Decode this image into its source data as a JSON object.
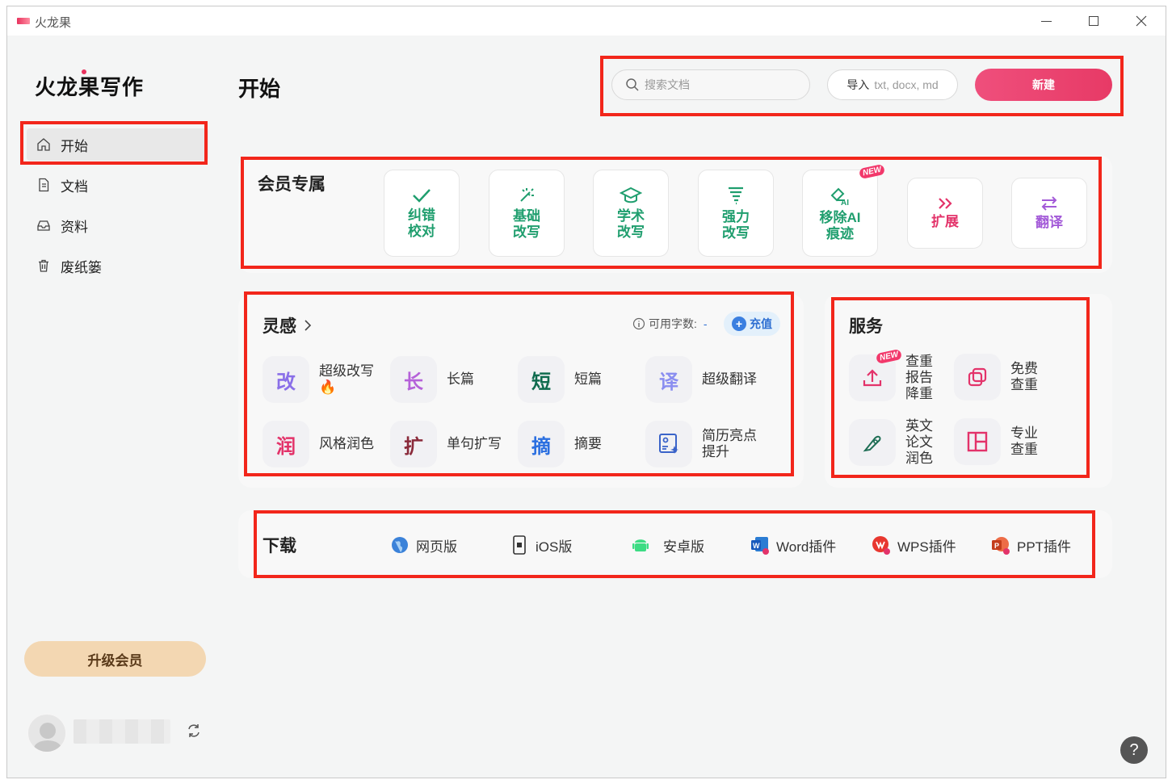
{
  "window": {
    "title": "火龙果"
  },
  "sidebar": {
    "logo": "火龙果写作",
    "items": [
      {
        "label": "开始",
        "icon": "home-icon",
        "active": true
      },
      {
        "label": "文档",
        "icon": "document-icon"
      },
      {
        "label": "资料",
        "icon": "inbox-icon"
      },
      {
        "label": "废纸篓",
        "icon": "trash-icon"
      }
    ],
    "upgrade_label": "升级会员"
  },
  "header": {
    "title": "开始",
    "search_placeholder": "搜索文档",
    "import_label": "导入",
    "import_hint": "txt, docx, md",
    "new_label": "新建"
  },
  "vip": {
    "title": "会员专属",
    "tiles": [
      {
        "label_1": "纠错",
        "label_2": "校对",
        "icon": "check-icon",
        "color": "#1f9e6e"
      },
      {
        "label_1": "基础",
        "label_2": "改写",
        "icon": "magic-wand-icon",
        "color": "#1f9e6e"
      },
      {
        "label_1": "学术",
        "label_2": "改写",
        "icon": "graduation-cap-icon",
        "color": "#1f9e6e"
      },
      {
        "label_1": "强力",
        "label_2": "改写",
        "icon": "tornado-icon",
        "color": "#1f9e6e"
      },
      {
        "label_1": "移除AI",
        "label_2": "痕迹",
        "icon": "ai-eraser-icon",
        "color": "#1f9e6e",
        "badge": "NEW"
      },
      {
        "label_1": "扩展",
        "label_2": "",
        "icon": "double-chevron-right-icon",
        "color": "#e3336a"
      },
      {
        "label_1": "翻译",
        "label_2": "",
        "icon": "swap-arrows-icon",
        "color": "#a35ad8"
      }
    ]
  },
  "inspiration": {
    "title": "灵感",
    "quota_label": "可用字数:",
    "quota_value": "-",
    "recharge_label": "充值",
    "items": [
      {
        "glyph": "改",
        "label": "超级改写",
        "color": "#8a6fe8"
      },
      {
        "glyph": "长",
        "label": "长篇",
        "color": "#b561d9"
      },
      {
        "glyph": "短",
        "label": "短篇",
        "color": "#0f6b4e"
      },
      {
        "glyph": "译",
        "label": "超级翻译",
        "color": "#8a8ef0"
      },
      {
        "glyph": "润",
        "label": "风格润色",
        "color": "#e3336a"
      },
      {
        "glyph": "扩",
        "label": "单句扩写",
        "color": "#8a2a3a"
      },
      {
        "glyph": "摘",
        "label": "摘要",
        "color": "#2b6fe0"
      },
      {
        "glyph": "",
        "label": "简历亮点提升",
        "color": "#3a63c9"
      }
    ]
  },
  "service": {
    "title": "服务",
    "items": [
      {
        "label_1": "查重",
        "label_2": "报告",
        "label_3": "降重",
        "icon": "upload-icon",
        "badge": "NEW"
      },
      {
        "label_1": "免费",
        "label_2": "查重",
        "label_3": "",
        "icon": "copy-icon"
      },
      {
        "label_1": "英文",
        "label_2": "论文",
        "label_3": "润色",
        "icon": "feather-pen-icon"
      },
      {
        "label_1": "专业",
        "label_2": "查重",
        "label_3": "",
        "icon": "layout-icon"
      }
    ]
  },
  "download": {
    "title": "下载",
    "items": [
      {
        "label": "网页版",
        "icon": "globe-icon"
      },
      {
        "label": "iOS版",
        "icon": "phone-icon"
      },
      {
        "label": "安卓版",
        "icon": "android-icon"
      },
      {
        "label": "Word插件",
        "icon": "word-icon"
      },
      {
        "label": "WPS插件",
        "icon": "wps-icon"
      },
      {
        "label": "PPT插件",
        "icon": "ppt-icon"
      }
    ]
  },
  "colors": {
    "accent": "#e73a66",
    "highlight_box": "#f2261b",
    "upgrade_bg": "#f3d7b2"
  }
}
